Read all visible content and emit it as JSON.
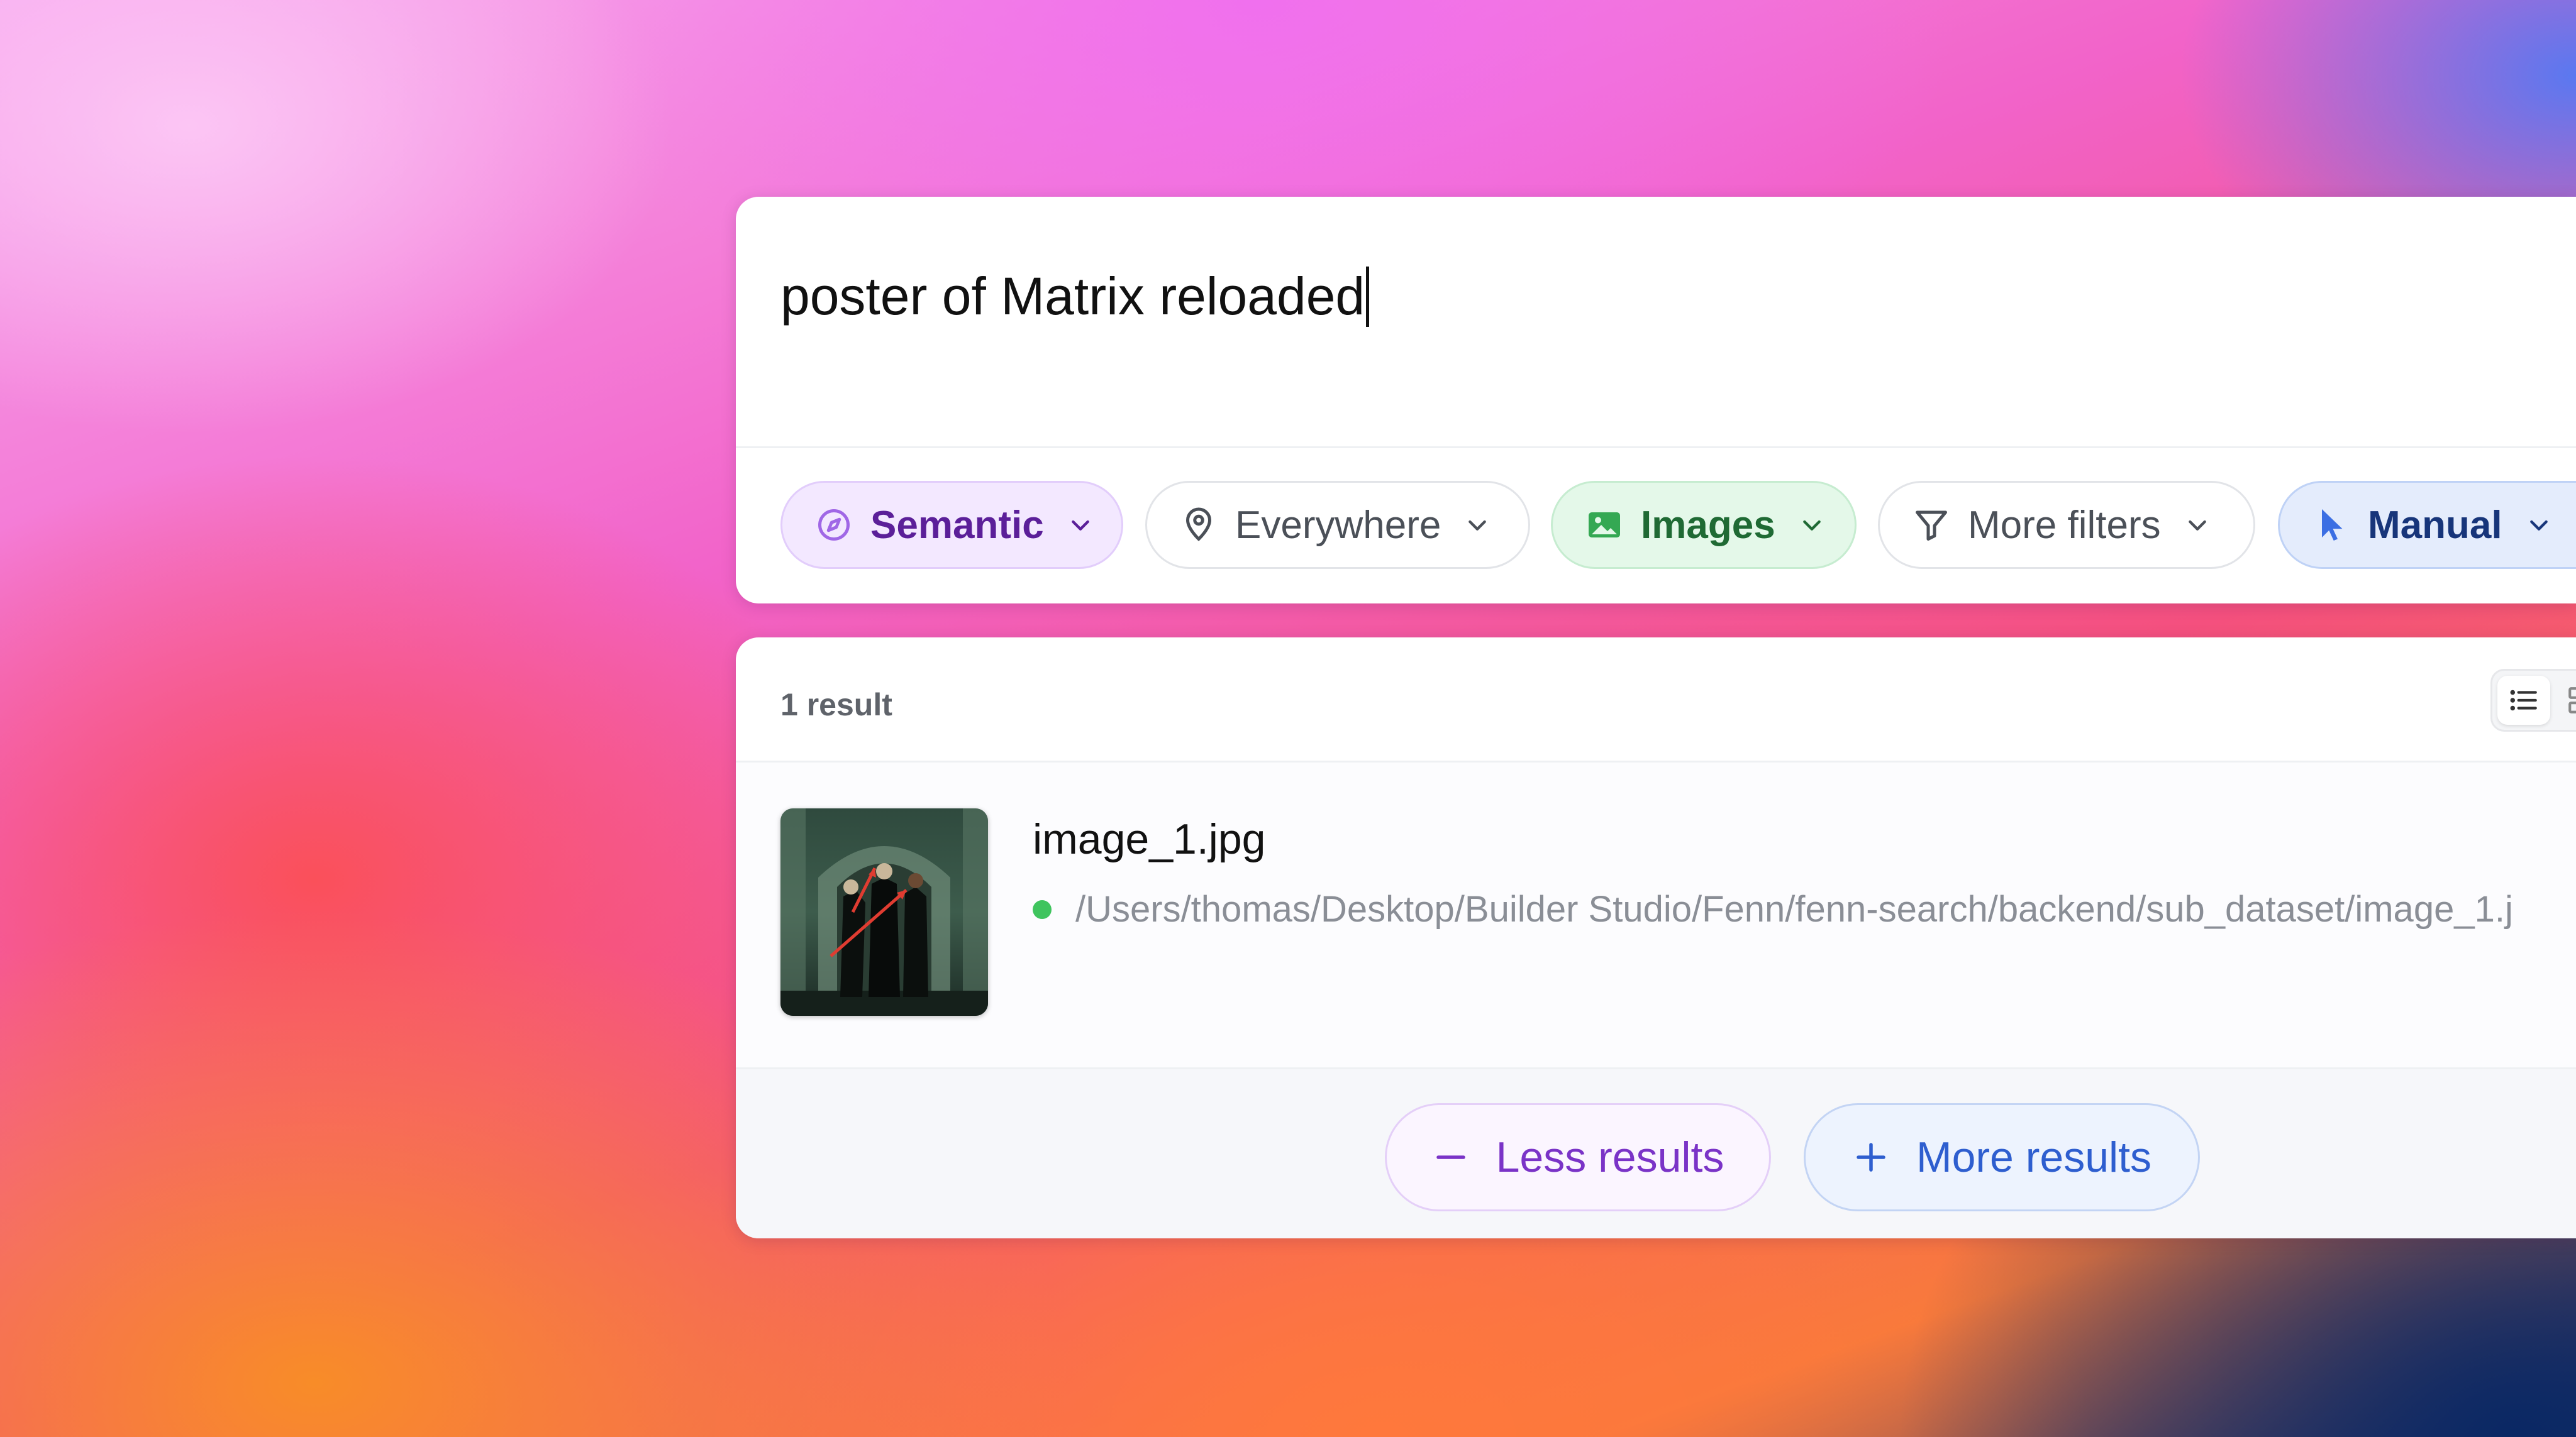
{
  "search": {
    "query": "poster of Matrix reloaded"
  },
  "filters": {
    "semantic": {
      "label": "Semantic",
      "icon": "compass-icon",
      "color": "#5b1f99"
    },
    "location": {
      "label": "Everywhere",
      "icon": "location-pin-icon"
    },
    "type": {
      "label": "Images",
      "icon": "image-icon",
      "color": "#1f6a34"
    },
    "more": {
      "label": "More filters",
      "icon": "filter-icon"
    },
    "mode": {
      "label": "Manual",
      "icon": "cursor-icon",
      "color": "#17357a"
    }
  },
  "results": {
    "count_label": "1 result",
    "view_modes": [
      "list-icon",
      "grid-icon"
    ],
    "items": [
      {
        "name": "image_1.jpg",
        "path": "/Users/thomas/Desktop/Builder Studio/Fenn/fenn-search/backend/sub_dataset/image_1.j",
        "status_color": "#3fc45e"
      }
    ],
    "less_label": "Less results",
    "more_label": "More results"
  }
}
